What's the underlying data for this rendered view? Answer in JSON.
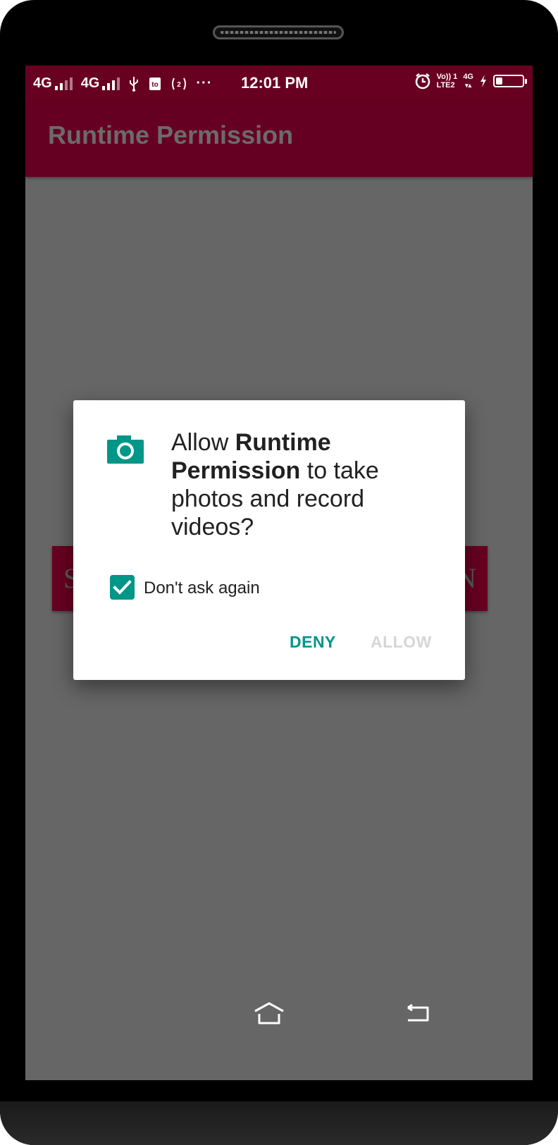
{
  "status_bar": {
    "network1": "4G",
    "network2": "4G",
    "time": "12:01 PM",
    "volte_label": "Vo)) 1",
    "lte_label": "LTE2",
    "network_right": "4G",
    "battery_level": 0.25,
    "icons": [
      "signal-icon",
      "usb-icon",
      "storage-icon",
      "hotspot-icon",
      "more-icon",
      "alarm-icon",
      "charging-icon",
      "battery-icon"
    ]
  },
  "app_bar": {
    "title": "Runtime Permission"
  },
  "background_button": {
    "left_fragment": "S",
    "right_fragment": "N"
  },
  "dialog": {
    "icon": "camera-icon",
    "message_prefix": "Allow ",
    "app_name": "Runtime Permission",
    "message_suffix": " to take photos and record videos?",
    "checkbox_label": "Don't ask again",
    "checkbox_checked": true,
    "deny_label": "DENY",
    "allow_label": "ALLOW",
    "accent_color": "#009688"
  },
  "nav_bar": {
    "icons": [
      "home-icon",
      "back-icon"
    ]
  },
  "colors": {
    "primary": "#680022",
    "scrim": "#666666"
  }
}
